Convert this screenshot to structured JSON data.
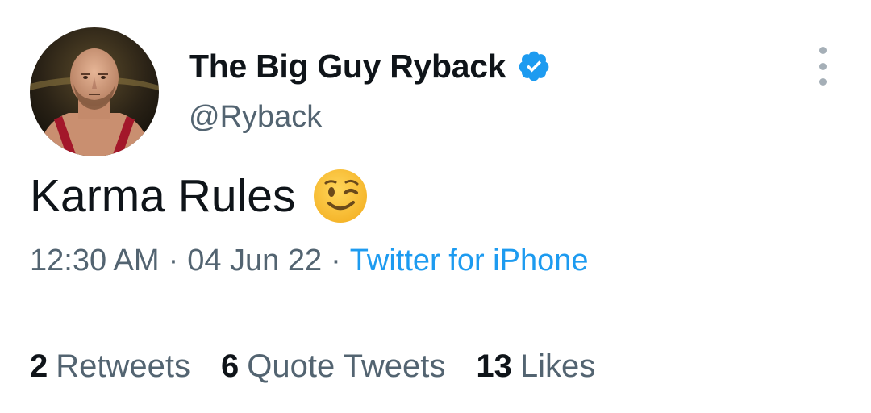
{
  "author": {
    "display_name": "The Big Guy Ryback",
    "handle": "@Ryback",
    "verified_icon": "verified-badge-icon",
    "verified_color": "#1d9bf0"
  },
  "tweet": {
    "text": "Karma Rules",
    "emoji": "winking-face-emoji"
  },
  "meta": {
    "time": "12:30 AM",
    "separator": "·",
    "date": "04 Jun 22",
    "source": "Twitter for iPhone"
  },
  "stats": [
    {
      "count": "2",
      "label": "Retweets"
    },
    {
      "count": "6",
      "label": "Quote Tweets"
    },
    {
      "count": "13",
      "label": "Likes"
    }
  ],
  "colors": {
    "text": "#0f1419",
    "secondary": "#536471",
    "link": "#1d9bf0",
    "divider": "#dadfe3"
  }
}
